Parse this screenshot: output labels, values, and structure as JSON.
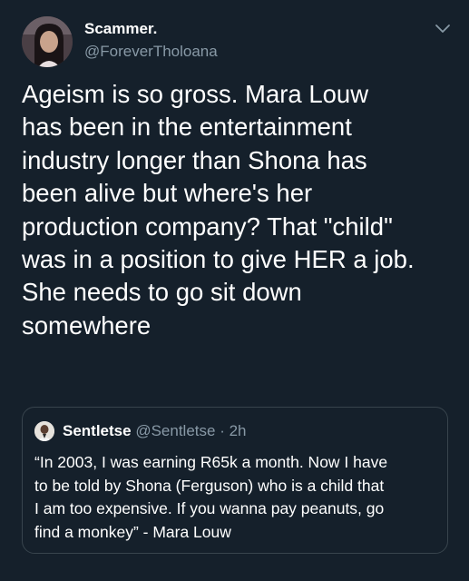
{
  "colors": {
    "background": "#15202b",
    "text_primary": "#ffffff",
    "text_secondary": "#8899a6",
    "border": "#38444d"
  },
  "tweet": {
    "author_name": "Scammer.",
    "author_handle": "@ForeverTholoana",
    "avatar_icon": "profile-photo",
    "menu_icon": "chevron-down-icon",
    "text": "Ageism is so gross. Mara Louw\nhas been in the entertainment\nindustry longer than Shona has\nbeen alive but where's her\nproduction company? That \"child\"\nwas in a position to give HER a job.\nShe needs to go sit down\nsomewhere"
  },
  "quoted_tweet": {
    "author_name": "Sentletse",
    "author_handle": "@Sentletse · 2h",
    "avatar_icon": "profile-photo",
    "text": "“In 2003, I was earning R65k a month. Now I have\nto be told by Shona (Ferguson) who is a child that\nI am too expensive. If you wanna pay peanuts, go\nfind a monkey” - Mara Louw"
  }
}
